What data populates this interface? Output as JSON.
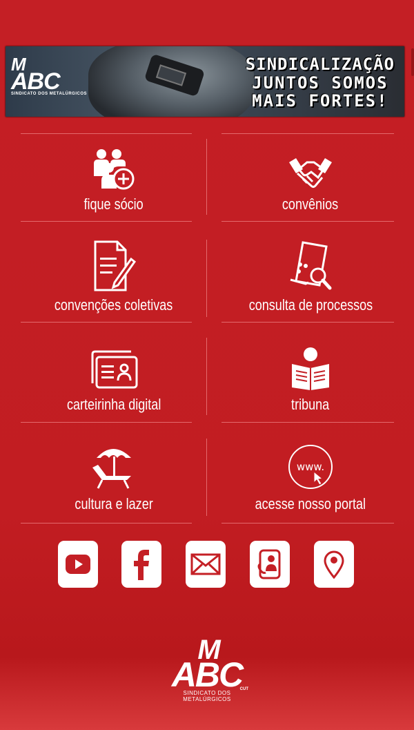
{
  "banner": {
    "logo_top": "M",
    "logo_main": "ABC",
    "logo_sub": "SINDICATO DOS METALÚRGICOS",
    "line1": "SINDICALIZAÇÃO",
    "line2": "JUNTOS SOMOS",
    "line3": "MAIS FORTES!"
  },
  "menu": {
    "items": [
      {
        "label": "fique sócio",
        "icon": "add-user-icon"
      },
      {
        "label": "convênios",
        "icon": "handshake-icon"
      },
      {
        "label": "convenções coletivas",
        "icon": "document-pen-icon"
      },
      {
        "label": "consulta de processos",
        "icon": "document-search-icon"
      },
      {
        "label": "carteirinha digital",
        "icon": "id-card-icon"
      },
      {
        "label": "tribuna",
        "icon": "reader-icon"
      },
      {
        "label": "cultura e lazer",
        "icon": "beach-chair-icon"
      },
      {
        "label": "acesse nosso portal",
        "icon": "www-icon"
      }
    ]
  },
  "social": [
    {
      "name": "youtube-icon"
    },
    {
      "name": "facebook-icon"
    },
    {
      "name": "email-icon"
    },
    {
      "name": "phone-contact-icon"
    },
    {
      "name": "map-pin-icon"
    }
  ],
  "footer": {
    "logo_top": "M",
    "logo_main": "ABC",
    "logo_sub": "SINDICATO DOS METALÚRGICOS",
    "logo_tag": "CUT"
  },
  "colors": {
    "background": "#c41f25",
    "divider": "#e46a6d",
    "icon": "#ffffff",
    "social_icon": "#c41f25"
  }
}
